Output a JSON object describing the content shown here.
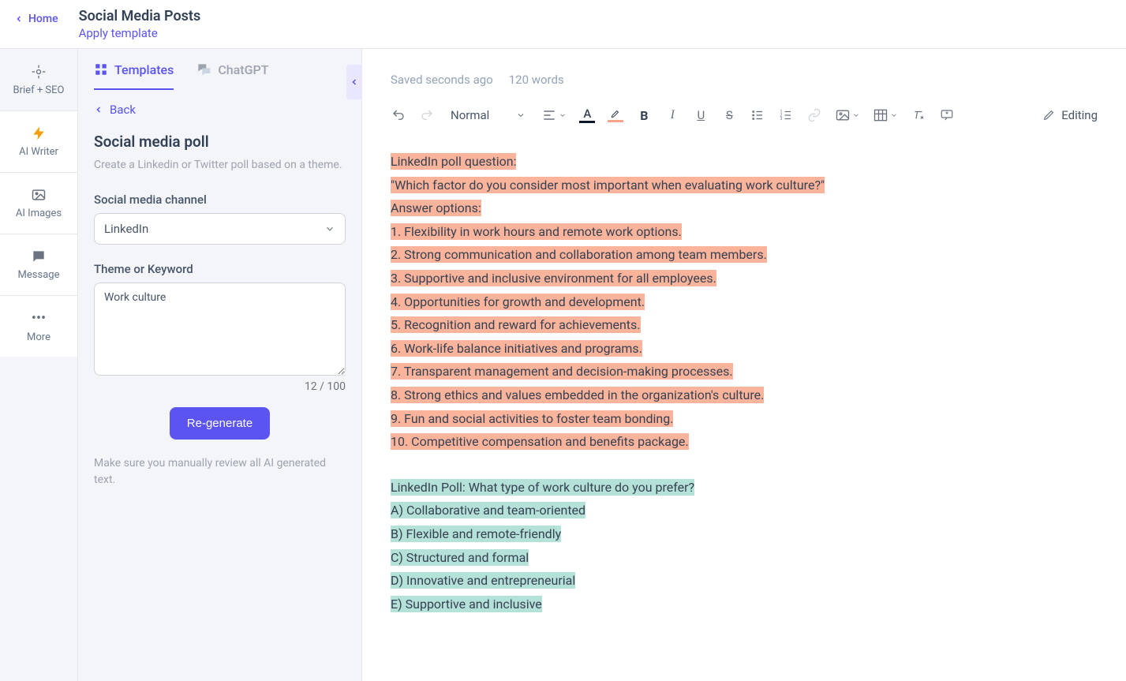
{
  "header": {
    "home_label": "Home",
    "page_title": "Social Media Posts",
    "apply_link": "Apply template"
  },
  "rail": [
    {
      "name": "brief-seo",
      "label": "Brief + SEO"
    },
    {
      "name": "ai-writer",
      "label": "AI Writer"
    },
    {
      "name": "ai-images",
      "label": "AI Images"
    },
    {
      "name": "message",
      "label": "Message"
    },
    {
      "name": "more",
      "label": "More"
    }
  ],
  "panel": {
    "tabs": {
      "templates": "Templates",
      "chatgpt": "ChatGPT"
    },
    "back_label": "Back",
    "template_title": "Social media poll",
    "template_desc": "Create a Linkedin or Twitter poll based on a theme.",
    "channel_label": "Social media channel",
    "channel_value": "LinkedIn",
    "theme_label": "Theme or Keyword",
    "theme_value": "Work culture",
    "char_count": "12 / 100",
    "regen_label": "Re-generate",
    "note": "Make sure you manually review all AI generated text."
  },
  "editor": {
    "saved": "Saved seconds ago",
    "wordcount": "120 words",
    "format_label": "Normal",
    "editing_label": "Editing",
    "orange_lines": [
      "LinkedIn poll question:",
      "\"Which factor do you consider most important when evaluating work culture?\"",
      "Answer options:",
      "1. Flexibility in work hours and remote work options.",
      "2. Strong communication and collaboration among team members.",
      "3. Supportive and inclusive environment for all employees.",
      "4. Opportunities for growth and development.",
      "5. Recognition and reward for achievements.",
      "6. Work-life balance initiatives and programs.",
      "7. Transparent management and decision-making processes.",
      "8. Strong ethics and values embedded in the organization's culture.",
      "9. Fun and social activities to foster team bonding.",
      "10. Competitive compensation and benefits package."
    ],
    "teal_lines": [
      "LinkedIn Poll: What type of work culture do you prefer?",
      "A) Collaborative and team-oriented",
      "B) Flexible and remote-friendly",
      "C) Structured and formal",
      "D) Innovative and entrepreneurial",
      "E) Supportive and inclusive"
    ]
  }
}
